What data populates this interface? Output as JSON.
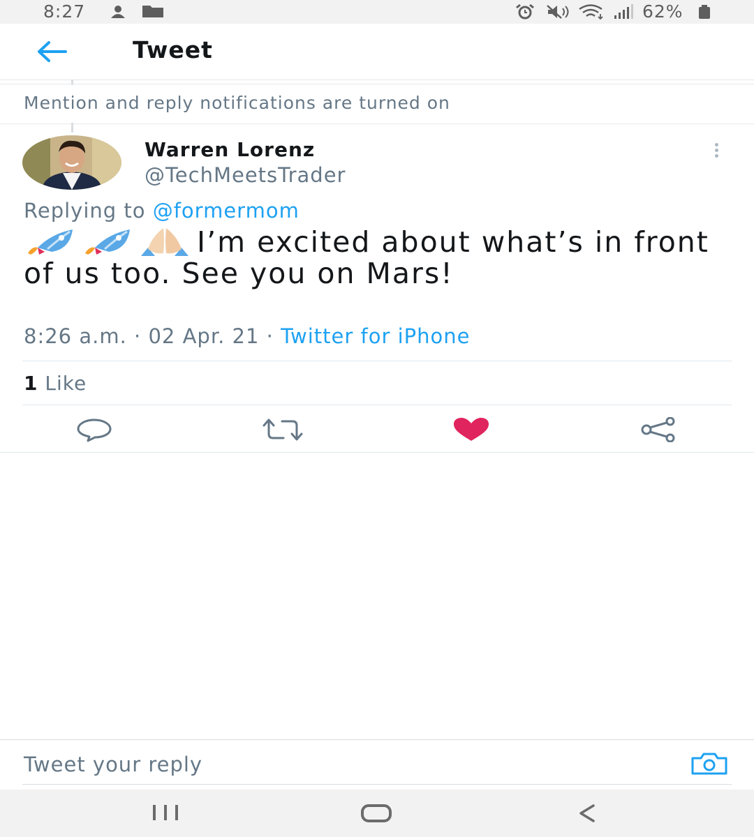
{
  "status_bar": {
    "time": "8:27",
    "battery_percent": "62%",
    "icons": [
      "ghost-app-icon",
      "folder-icon",
      "alarm-icon",
      "mute-icon",
      "wifi-icon",
      "signal-icon",
      "battery-icon"
    ]
  },
  "header": {
    "title": "Tweet",
    "back_icon": "arrow-left-icon"
  },
  "notice": {
    "text": "Mention and reply notifications are turned on"
  },
  "tweet": {
    "author_name": "Warren Lorenz",
    "author_handle": "@TechMeetsTrader",
    "replying_prefix": "Replying to",
    "replying_to": "@formermom",
    "emojis": [
      "rocket",
      "rocket",
      "folded-hands"
    ],
    "text": "I’m excited about what’s in front of us too. See you on Mars!",
    "time": "8:26 a.m.",
    "sep1": " · ",
    "date": "02 Apr. 21",
    "sep2": " · ",
    "source": "Twitter for iPhone",
    "like_count": "1",
    "like_label": "Like"
  },
  "actions": [
    "reply-icon",
    "retweet-icon",
    "like-icon",
    "share-icon"
  ],
  "reply_bar": {
    "placeholder": "Tweet your reply"
  },
  "colors": {
    "accent": "#1da1f2",
    "like": "#e0245e",
    "secondary_text": "#657786",
    "primary_text": "#14171a"
  }
}
